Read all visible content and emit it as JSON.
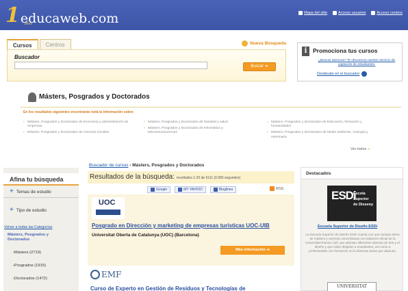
{
  "header": {
    "logo_one": "1",
    "logo_text": "educaweb.com",
    "logo_sub": "años",
    "links": [
      "Mapa del sitio",
      "Acceso usuarios",
      "Acceso centros"
    ]
  },
  "search": {
    "tabs": [
      "Cursos",
      "Centros"
    ],
    "nueva_busqueda": "Nueva Búsqueda",
    "buscador_label": "Buscador",
    "input_value": "",
    "button": "Buscar ➔"
  },
  "promo": {
    "title": "Promociona tus cursos",
    "desc": "¿Buscas alumnos? Te ofrecemos nuestro servicio de captación de estudiantes.",
    "link": "Destácate en el buscador"
  },
  "masters": {
    "title": "Másters, Posgrados y Doctorados",
    "intro": "En los resultados siguientes encontrarás toda la información sobre:",
    "col1": [
      "Másters, Posgrados y Doctorados de Economía y administración de empresas",
      "Másters, Posgrados y Doctorados de Ciencias sociales"
    ],
    "col2": [
      "Másters, Posgrados y Doctorados de Sanidad y salud",
      "Másters, Posgrados y Doctorados de Informática y telecomunicaciones"
    ],
    "col3": [
      "Másters, Posgrados y Doctorados de Educación, formación y humanidades",
      "Másters, Posgrados y Doctorados de Medio ambiente, zoología y veterinaria"
    ],
    "ver_todos": "Ver todos",
    "ver_arrow": "»"
  },
  "sidebar": {
    "title": "Afina tu búsqueda",
    "filters": [
      "Temas de estudio",
      "Tipo de estudio"
    ],
    "volver": "Volver a todas las Categorías",
    "selected": "Másters, Posgrados y Doctorados",
    "counts": [
      "›Másters (2719)",
      "›Posgrados (1915)",
      "›Doctorados (1472)"
    ]
  },
  "results": {
    "crumb_link": "Buscador de cursos",
    "crumb_sep": "›",
    "crumb_current": "Másters, Posgrados y Doctorados",
    "head": "Resultados de la búsqueda:",
    "meta": "resultados 1-20 de 6111 (0.083 segundos)",
    "share": [
      "Google",
      "MY YAHOO!",
      "Bloglines"
    ],
    "rss": "RSS",
    "r1_logo": "UOC",
    "r1_title": "Posgrado en Dirección y marketing de empresas turísticas UOC-UIB",
    "r1_inst": "Universitat Oberta de Catalunya (UOC) (Barcelona)",
    "r1_button": "Más información  ➔",
    "r2_logo": "EMF",
    "r2_title": "Curso de Experto en Gestión de Residuos y Tecnologías de"
  },
  "destacados": {
    "title": "Destacados",
    "logo_letters": "ESDi",
    "logo_text": "Escola Superior de Disseny",
    "link": "Escuela Superior de Diseño ESDi",
    "desc": "La Escuela Superior de Diseño ESDi cuenta con una variada oferta de másters y carreras universitarias con titulación oficial de la Universitat Ramon Llull, que alientan diferentes talentos de arte y el diseño y que están dirigidos a estudiantes, así como a profesionales con formación en la diversas áreas que abarcan.",
    "univ": "UNIVERSITAT"
  }
}
